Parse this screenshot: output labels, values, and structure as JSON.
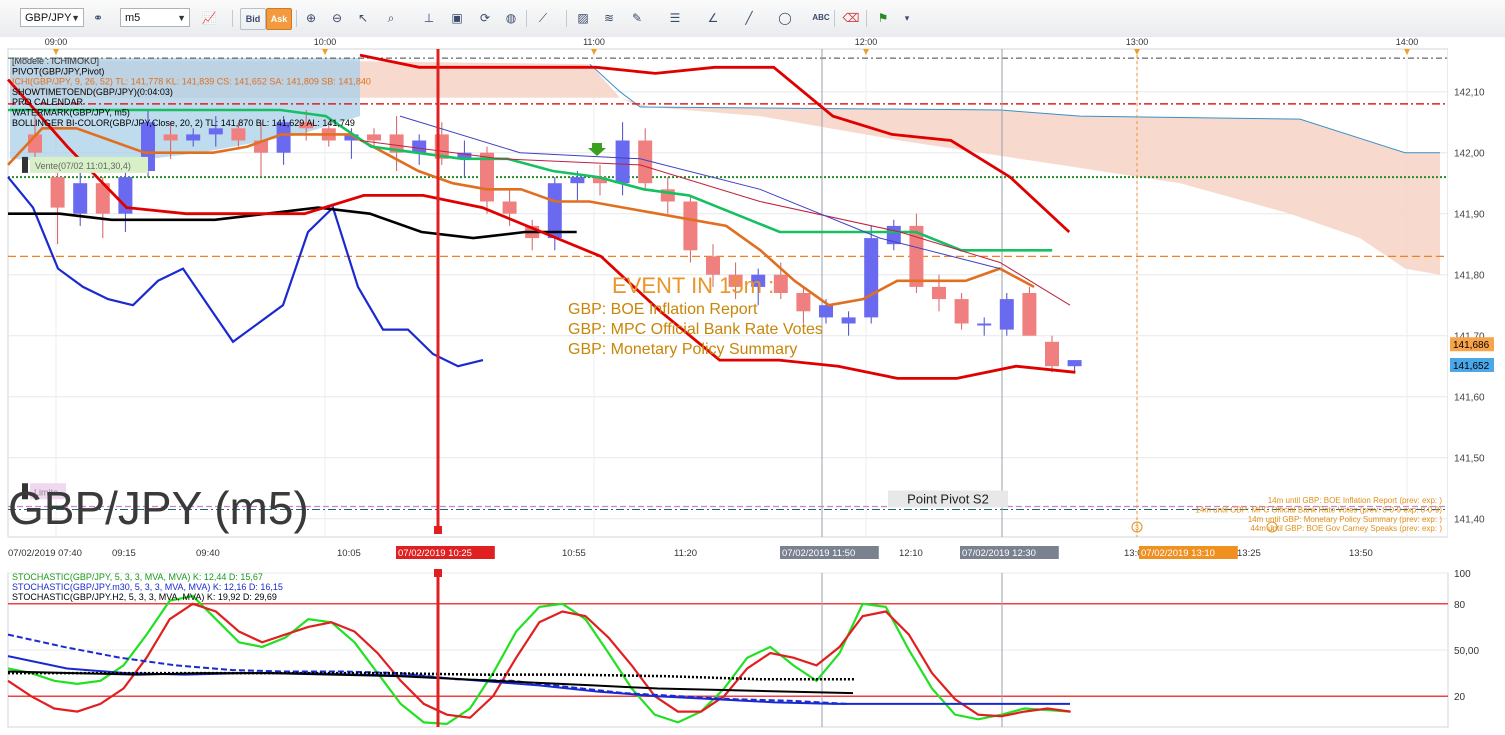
{
  "toolbar": {
    "symbol": "GBP/JPY",
    "timeframe": "m5",
    "bid_label": "Bid",
    "ask_label": "Ask",
    "icons": [
      "chart-type-icon",
      "bid-button",
      "ask-button",
      "zoom-in-icon",
      "zoom-out-icon",
      "cursor-icon",
      "zoom-rect-icon",
      "indicator-icon",
      "template-icon",
      "refresh-icon",
      "globe-icon",
      "ruler-icon",
      "image-icon",
      "fibonacci-icon",
      "lines-icon",
      "pen-icon",
      "trendline-icon",
      "ellipse-icon",
      "text-icon",
      "eraser-icon",
      "objects-icon",
      "more-icon"
    ]
  },
  "main_chart": {
    "watermark": "GBP/JPY (m5)",
    "legend": [
      {
        "text": "[Modele : ICHIMOKU]",
        "color": "#333333"
      },
      {
        "text": "PIVOT(GBP/JPY,Pivot)",
        "color": "#000000"
      },
      {
        "text": "ICHI(GBP/JPY, 9, 26, 52)  TL: 141,778   KL: 141,839   CS: 141,652   SA: 141,809   SB: 141,840",
        "color": "#e07020"
      },
      {
        "text": "SHOWTIMETOEND(GBP/JPY)(0:04:03)",
        "color": "#000000"
      },
      {
        "text": "PRO CALENDAR",
        "color": "#000000"
      },
      {
        "text": "WATERMARK(GBP/JPY, m5)",
        "color": "#000000"
      },
      {
        "text": "BOLLINGER BI-COLOR(GBP/JPY,Close, 20, 2)  TL: 141,870  BL: 141,629  AL: 141,749",
        "color": "#000000"
      }
    ],
    "top_time_labels": [
      "09:00",
      "10:00",
      "11:00",
      "12:00",
      "13:00",
      "14:00"
    ],
    "price_ticks": [
      "142,10",
      "142,00",
      "141,90",
      "141,80",
      "141,70",
      "141,60",
      "141,50",
      "141,40"
    ],
    "price_badges": [
      {
        "text": "141,686",
        "color": "#f7a44a"
      },
      {
        "text": "141,652",
        "color": "#4aa8e8"
      }
    ],
    "order_labels": {
      "sell": "Vente(07/02 11:01,30,4)",
      "limit": "Limite"
    },
    "pivot_label": "Point Pivot S2",
    "event_title": "EVENT IN 15m :",
    "event_lines": [
      "GBP: BOE Inflation Report",
      "GBP: MPC Official Bank Rate Votes",
      "GBP: Monetary Policy Summary"
    ],
    "calendar_notes": [
      "14m until GBP: BOE Inflation Report (prev:  exp: )",
      "14m until GBP: MPC Official Bank Rate Votes (prev: 0-0-9 exp: 0-0-9)",
      "14m until GBP: Monetary Policy Summary (prev:  exp: )",
      "44m until GBP: BOE Gov Carney Speaks (prev:  exp: )"
    ],
    "calendar_markers": [
      "3",
      "1"
    ]
  },
  "time_axis": {
    "labels": [
      {
        "text": "07/02/2019 07:40",
        "highlight": ""
      },
      {
        "text": "09:15",
        "highlight": ""
      },
      {
        "text": "09:40",
        "highlight": ""
      },
      {
        "text": "10:05",
        "highlight": ""
      },
      {
        "text": "07/02/2019 10:25",
        "highlight": "#e02020"
      },
      {
        "text": "10:55",
        "highlight": ""
      },
      {
        "text": "11:20",
        "highlight": ""
      },
      {
        "text": "07/02/2019 11:50",
        "highlight": "#7a8290"
      },
      {
        "text": "12:10",
        "highlight": ""
      },
      {
        "text": "07/02/2019 12:30",
        "highlight": "#7a8290"
      },
      {
        "text": "13:00",
        "highlight": ""
      },
      {
        "text": "07/02/2019 13:10",
        "highlight": "#f09020"
      },
      {
        "text": "13:25",
        "highlight": ""
      },
      {
        "text": "13:50",
        "highlight": ""
      }
    ]
  },
  "stoch_panel": {
    "legend": [
      {
        "text": "STOCHASTIC(GBP/JPY, 5, 3, 3, MVA, MVA)  K: 12,44   D: 15,67",
        "color": "#1a9a1a"
      },
      {
        "text": "STOCHASTIC(GBP/JPY.m30, 5, 3, 3, MVA, MVA)  K: 12,16   D: 16,15",
        "color": "#1a2ad0"
      },
      {
        "text": "STOCHASTIC(GBP/JPY.H2, 5, 3, 3, MVA, MVA)  K: 19,92   D: 29,69",
        "color": "#000000"
      }
    ],
    "ticks": [
      "100",
      "80",
      "50,00",
      "20"
    ]
  },
  "chart_data": {
    "type": "line",
    "symbol": "GBP/JPY",
    "timeframe": "m5",
    "price_range": [
      141.37,
      142.17
    ],
    "candles": [
      {
        "o": 142.03,
        "h": 142.06,
        "l": 141.98,
        "c": 142.0
      },
      {
        "o": 141.96,
        "h": 141.98,
        "l": 141.85,
        "c": 141.91
      },
      {
        "o": 141.9,
        "h": 141.97,
        "l": 141.88,
        "c": 141.95
      },
      {
        "o": 141.95,
        "h": 141.96,
        "l": 141.86,
        "c": 141.9
      },
      {
        "o": 141.9,
        "h": 141.99,
        "l": 141.87,
        "c": 141.96
      },
      {
        "o": 141.97,
        "h": 142.07,
        "l": 141.96,
        "c": 142.05
      },
      {
        "o": 142.03,
        "h": 142.05,
        "l": 141.99,
        "c": 142.02
      },
      {
        "o": 142.02,
        "h": 142.04,
        "l": 142.01,
        "c": 142.03
      },
      {
        "o": 142.03,
        "h": 142.06,
        "l": 142.01,
        "c": 142.04
      },
      {
        "o": 142.04,
        "h": 142.05,
        "l": 142.01,
        "c": 142.02
      },
      {
        "o": 142.02,
        "h": 142.05,
        "l": 141.96,
        "c": 142.0
      },
      {
        "o": 142.0,
        "h": 142.06,
        "l": 141.98,
        "c": 142.05
      },
      {
        "o": 142.05,
        "h": 142.07,
        "l": 142.02,
        "c": 142.04
      },
      {
        "o": 142.04,
        "h": 142.05,
        "l": 142.01,
        "c": 142.02
      },
      {
        "o": 142.02,
        "h": 142.04,
        "l": 141.99,
        "c": 142.03
      },
      {
        "o": 142.03,
        "h": 142.04,
        "l": 142.01,
        "c": 142.02
      },
      {
        "o": 142.03,
        "h": 142.06,
        "l": 141.97,
        "c": 142.0
      },
      {
        "o": 142.0,
        "h": 142.03,
        "l": 141.98,
        "c": 142.02
      },
      {
        "o": 142.03,
        "h": 142.05,
        "l": 141.98,
        "c": 141.99
      },
      {
        "o": 141.99,
        "h": 142.02,
        "l": 141.96,
        "c": 142.0
      },
      {
        "o": 142.0,
        "h": 142.01,
        "l": 141.9,
        "c": 141.92
      },
      {
        "o": 141.92,
        "h": 141.94,
        "l": 141.88,
        "c": 141.9
      },
      {
        "o": 141.88,
        "h": 141.89,
        "l": 141.84,
        "c": 141.86
      },
      {
        "o": 141.86,
        "h": 141.96,
        "l": 141.84,
        "c": 141.95
      },
      {
        "o": 141.95,
        "h": 141.97,
        "l": 141.92,
        "c": 141.96
      },
      {
        "o": 141.96,
        "h": 141.98,
        "l": 141.93,
        "c": 141.95
      },
      {
        "o": 141.95,
        "h": 142.05,
        "l": 141.93,
        "c": 142.02
      },
      {
        "o": 142.02,
        "h": 142.04,
        "l": 141.94,
        "c": 141.95
      },
      {
        "o": 141.94,
        "h": 141.96,
        "l": 141.9,
        "c": 141.92
      },
      {
        "o": 141.92,
        "h": 141.93,
        "l": 141.82,
        "c": 141.84
      },
      {
        "o": 141.83,
        "h": 141.85,
        "l": 141.78,
        "c": 141.8
      },
      {
        "o": 141.8,
        "h": 141.82,
        "l": 141.76,
        "c": 141.78
      },
      {
        "o": 141.78,
        "h": 141.81,
        "l": 141.75,
        "c": 141.8
      },
      {
        "o": 141.8,
        "h": 141.82,
        "l": 141.76,
        "c": 141.77
      },
      {
        "o": 141.77,
        "h": 141.78,
        "l": 141.72,
        "c": 141.74
      },
      {
        "o": 141.73,
        "h": 141.76,
        "l": 141.72,
        "c": 141.75
      },
      {
        "o": 141.72,
        "h": 141.74,
        "l": 141.7,
        "c": 141.73
      },
      {
        "o": 141.73,
        "h": 141.88,
        "l": 141.72,
        "c": 141.86
      },
      {
        "o": 141.85,
        "h": 141.89,
        "l": 141.84,
        "c": 141.88
      },
      {
        "o": 141.88,
        "h": 141.9,
        "l": 141.77,
        "c": 141.78
      },
      {
        "o": 141.78,
        "h": 141.8,
        "l": 141.74,
        "c": 141.76
      },
      {
        "o": 141.76,
        "h": 141.77,
        "l": 141.71,
        "c": 141.72
      },
      {
        "o": 141.72,
        "h": 141.73,
        "l": 141.7,
        "c": 141.72
      },
      {
        "o": 141.71,
        "h": 141.77,
        "l": 141.7,
        "c": 141.76
      },
      {
        "o": 141.77,
        "h": 141.78,
        "l": 141.7,
        "c": 141.7
      },
      {
        "o": 141.69,
        "h": 141.7,
        "l": 141.64,
        "c": 141.65
      },
      {
        "o": 141.65,
        "h": 141.66,
        "l": 141.64,
        "c": 141.66
      }
    ],
    "series": [
      {
        "name": "CS",
        "color": "#1a2ad0",
        "values": [
          141.96,
          141.91,
          141.81,
          141.78,
          141.76,
          141.75,
          141.79,
          141.81,
          141.75,
          141.69,
          141.72,
          141.75,
          141.87,
          141.91,
          141.78,
          141.71,
          141.71,
          141.67,
          141.65,
          141.66
        ]
      },
      {
        "name": "TL",
        "color": "#e07020",
        "values": [
          141.98,
          142.04,
          142.04,
          142.02,
          142.0,
          142.0,
          142.0,
          142.01,
          142.03,
          142.03,
          142.03,
          142.0,
          141.97,
          141.95,
          141.94,
          141.94,
          141.92,
          141.92,
          141.91,
          141.9,
          141.89,
          141.88,
          141.84,
          141.79,
          141.75,
          141.76,
          141.79,
          141.79,
          141.79,
          141.81,
          141.78
        ]
      },
      {
        "name": "KL",
        "color": "#16c060",
        "values": [
          142.07,
          142.07,
          142.07,
          142.07,
          142.07,
          142.07,
          142.07,
          142.06,
          142.01,
          142.0,
          141.99,
          141.99,
          141.97,
          141.96,
          141.94,
          141.93,
          141.9,
          141.87,
          141.87,
          141.87,
          141.87,
          141.84,
          141.84,
          141.84
        ]
      },
      {
        "name": "Pivot",
        "color": "#000000",
        "values": [
          141.9,
          141.9,
          141.89,
          141.89,
          141.89,
          141.9,
          141.91,
          141.9,
          141.87,
          141.86,
          141.87,
          141.87
        ]
      },
      {
        "name": "Bollinger",
        "color": "#e00000",
        "values": [
          142.12,
          142.01,
          141.91,
          141.9,
          141.9,
          141.9,
          141.93,
          141.93,
          141.91,
          141.87,
          141.83,
          141.74,
          141.66,
          141.66,
          141.65,
          141.63,
          141.63,
          141.65,
          141.64
        ]
      },
      {
        "name": "SB",
        "color": "#e00000",
        "values": [
          142.16,
          142.14,
          142.14,
          142.14,
          142.14,
          142.13,
          142.14,
          142.14,
          142.06,
          142.03,
          142.02,
          141.96,
          141.87
        ]
      }
    ],
    "levels": {
      "upper_dashdot": 142.08,
      "green_dotted": 141.96,
      "orange_dashed": 141.83,
      "pink_dashed": 141.42,
      "teal_dashdot": 141.415,
      "pivot_s2": 141.42,
      "current_bid": 141.652,
      "current_ask": 141.686
    },
    "stochastic": {
      "range": [
        0,
        100
      ],
      "bands": [
        20,
        80
      ],
      "series": [
        {
          "name": "K",
          "color": "#22e022",
          "values": [
            38,
            35,
            30,
            28,
            30,
            40,
            60,
            82,
            85,
            70,
            55,
            52,
            58,
            70,
            68,
            55,
            35,
            15,
            3,
            2,
            12,
            35,
            62,
            78,
            80,
            70,
            48,
            25,
            8,
            3,
            10,
            25,
            45,
            52,
            40,
            30,
            48,
            80,
            78,
            50,
            25,
            8,
            5,
            8,
            12,
            11,
            10
          ]
        },
        {
          "name": "D",
          "color": "#e02020",
          "values": [
            30,
            20,
            12,
            10,
            15,
            25,
            45,
            70,
            80,
            75,
            62,
            55,
            60,
            65,
            68,
            62,
            48,
            30,
            15,
            8,
            6,
            20,
            45,
            68,
            75,
            72,
            58,
            40,
            20,
            10,
            10,
            20,
            38,
            48,
            45,
            40,
            52,
            72,
            75,
            60,
            35,
            18,
            8,
            7,
            10,
            12,
            10
          ]
        },
        {
          "name": "m30 K",
          "color": "#1a2ad0",
          "values": [
            46,
            38,
            35,
            34,
            35,
            35,
            34,
            33,
            30,
            27,
            23,
            20,
            18,
            16,
            15,
            15,
            15,
            15,
            15
          ]
        },
        {
          "name": "m30 D",
          "color": "#1a2ad0",
          "values": [
            60,
            52,
            45,
            40,
            37,
            36,
            36,
            35,
            31,
            30,
            26,
            22,
            20,
            18,
            17,
            15
          ]
        },
        {
          "name": "H2 K",
          "color": "#000000",
          "values": [
            36,
            35,
            34,
            35,
            35,
            34,
            33,
            31,
            29,
            27,
            25,
            24,
            23,
            22
          ]
        },
        {
          "name": "H2 D",
          "color": "#000000",
          "values": [
            35,
            35,
            35,
            35,
            35,
            34,
            34,
            33,
            31,
            31
          ]
        }
      ]
    }
  }
}
